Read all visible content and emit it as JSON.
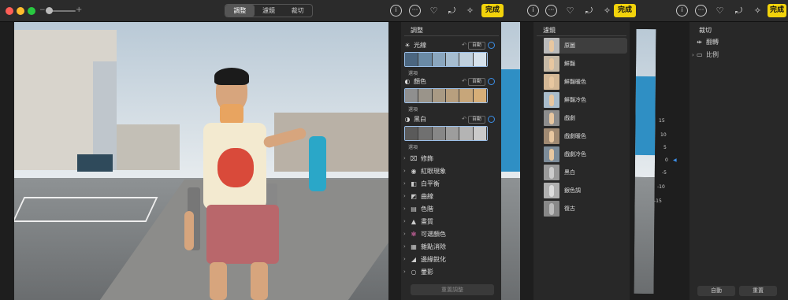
{
  "toolbar": {
    "tabs": [
      "調整",
      "濾鏡",
      "裁切"
    ],
    "active_tab": "調整",
    "done_label": "完成",
    "zoom_small_glyph": "−",
    "zoom_large_glyph": "+",
    "icons": [
      "info-icon",
      "more-icon",
      "heart-icon",
      "rotate-icon",
      "magic-wand-icon"
    ]
  },
  "adjust_panel": {
    "title": "調整",
    "auto_label": "自動",
    "options_label": "選項",
    "sections": [
      {
        "label": "光線",
        "icon": "sun-icon"
      },
      {
        "label": "顏色",
        "icon": "color-icon"
      },
      {
        "label": "黑白",
        "icon": "bw-icon"
      }
    ],
    "tools": [
      {
        "label": "修飾",
        "icon": "bandage-icon"
      },
      {
        "label": "紅眼現象",
        "icon": "eye-icon"
      },
      {
        "label": "白平衡",
        "icon": "wb-icon"
      },
      {
        "label": "曲線",
        "icon": "curves-icon"
      },
      {
        "label": "色階",
        "icon": "levels-icon"
      },
      {
        "label": "畫質",
        "icon": "definition-icon"
      },
      {
        "label": "可選顏色",
        "icon": "selective-color-icon"
      },
      {
        "label": "雜點消除",
        "icon": "noise-icon"
      },
      {
        "label": "邊緣銳化",
        "icon": "sharpen-icon"
      },
      {
        "label": "暈影",
        "icon": "vignette-icon"
      }
    ],
    "reset_label": "重置調整"
  },
  "filters_panel": {
    "title": "濾鏡",
    "filters": [
      "原圖",
      "鮮豔",
      "鮮豔暖色",
      "鮮豔冷色",
      "戲劇",
      "戲劇暖色",
      "戲劇冷色",
      "黑白",
      "銀色調",
      "復古"
    ],
    "selected": "原圖"
  },
  "crop_panel": {
    "title": "裁切",
    "items": [
      "翻轉",
      "比例"
    ],
    "auto_label": "自動",
    "reset_label": "重置",
    "dial_ticks": [
      "15",
      "10",
      "5",
      "0",
      "-5",
      "-10",
      "-15"
    ],
    "dial_value": 0
  },
  "colors": {
    "accent": "#f2d30b",
    "blue": "#3c8fe8"
  }
}
